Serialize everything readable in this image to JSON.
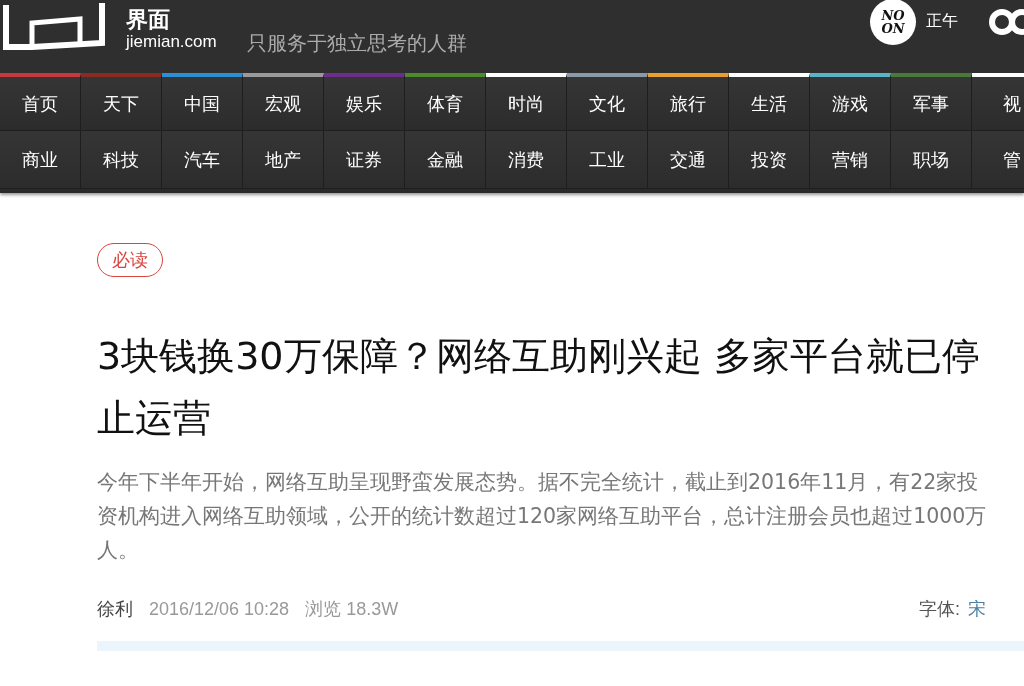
{
  "header": {
    "logo_text": "界面",
    "domain": "jiemian.com",
    "slogan": "只服务于独立思考的人群",
    "noon_badge": "NO ON",
    "noon_label": "正午"
  },
  "nav_rows": [
    {
      "items": [
        {
          "label": "首页",
          "color": "#c8383c"
        },
        {
          "label": "天下",
          "color": "#8b2a22"
        },
        {
          "label": "中国",
          "color": "#2b8fd6"
        },
        {
          "label": "宏观",
          "color": "#9a9a9a"
        },
        {
          "label": "娱乐",
          "color": "#6b2e8a"
        },
        {
          "label": "体育",
          "color": "#4c8a2a"
        },
        {
          "label": "时尚",
          "color": "#ffffff"
        },
        {
          "label": "文化",
          "color": "#8a9aa8"
        },
        {
          "label": "旅行",
          "color": "#e8a030"
        },
        {
          "label": "生活",
          "color": "#ffffff"
        },
        {
          "label": "游戏",
          "color": "#5ab4c4"
        },
        {
          "label": "军事",
          "color": "#4a7a3a"
        },
        {
          "label": "视",
          "color": "#ffffff"
        }
      ]
    },
    {
      "items": [
        {
          "label": "商业"
        },
        {
          "label": "科技"
        },
        {
          "label": "汽车"
        },
        {
          "label": "地产"
        },
        {
          "label": "证券"
        },
        {
          "label": "金融"
        },
        {
          "label": "消费"
        },
        {
          "label": "工业"
        },
        {
          "label": "交通"
        },
        {
          "label": "投资"
        },
        {
          "label": "营销"
        },
        {
          "label": "职场"
        },
        {
          "label": "管"
        }
      ]
    }
  ],
  "article": {
    "tag": "必读",
    "title": "3块钱换30万保障？网络互助刚兴起 多家平台就已停止运营",
    "summary": "今年下半年开始，网络互助呈现野蛮发展态势。据不完全统计，截止到2016年11月，有22家投资机构进入网络互助领域，公开的统计数超过120家网络互助平台，总计注册会员也超过1000万人。",
    "author": "徐利",
    "date": "2016/12/06 10:28",
    "views": "浏览 18.3W",
    "font_label": "字体:",
    "font_option": "宋"
  }
}
